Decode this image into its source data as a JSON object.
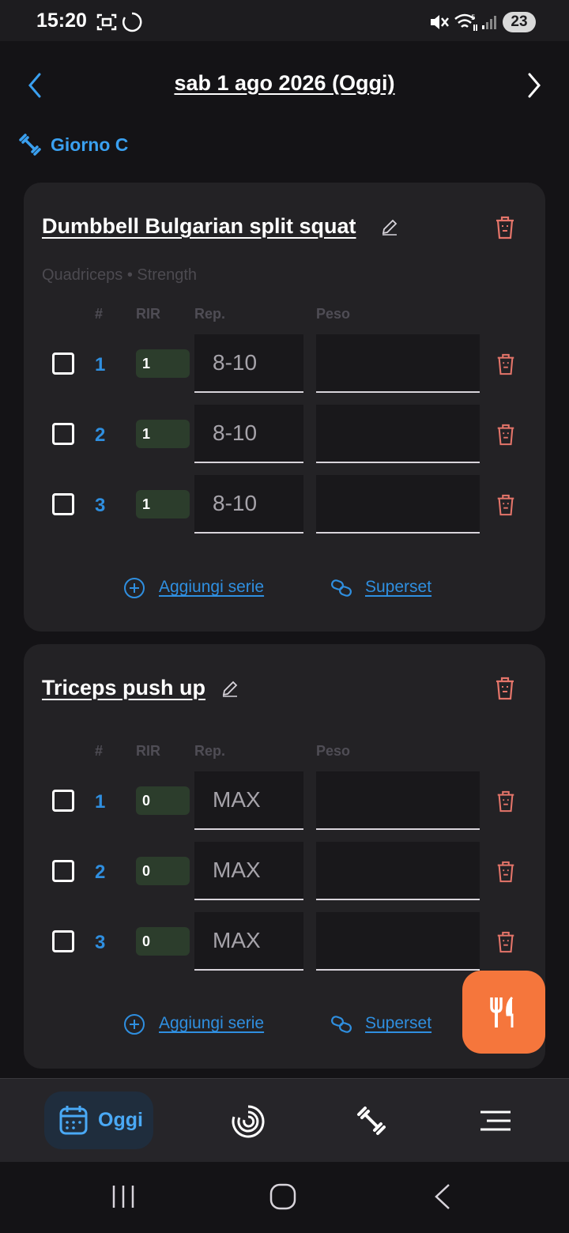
{
  "status_bar": {
    "time": "15:20",
    "battery": "23",
    "icons": [
      "screenshot-icon",
      "loading-circle-icon",
      "mute-icon",
      "wifi-icon",
      "signal-icon"
    ]
  },
  "header": {
    "date_title": "sab 1 ago 2026 (Oggi)",
    "prev_icon": "chevron-left-icon",
    "next_icon": "chevron-right-icon"
  },
  "workout_day": {
    "icon": "dumbbell-icon",
    "label": "Giorno C"
  },
  "columns": {
    "num": "#",
    "rir": "RIR",
    "rep": "Rep.",
    "peso": "Peso"
  },
  "exercises": [
    {
      "name": "Dumbbell Bulgarian split squat",
      "subtitle": "Quadriceps • Strength",
      "sets": [
        {
          "num": "1",
          "rir": "1",
          "rep": "8-10",
          "peso": ""
        },
        {
          "num": "2",
          "rir": "1",
          "rep": "8-10",
          "peso": ""
        },
        {
          "num": "3",
          "rir": "1",
          "rep": "8-10",
          "peso": ""
        }
      ],
      "add_set_label": "Aggiungi serie",
      "superset_label": "Superset"
    },
    {
      "name": "Triceps push up",
      "subtitle": "",
      "sets": [
        {
          "num": "1",
          "rir": "0",
          "rep": "MAX",
          "peso": ""
        },
        {
          "num": "2",
          "rir": "0",
          "rep": "MAX",
          "peso": ""
        },
        {
          "num": "3",
          "rir": "0",
          "rep": "MAX",
          "peso": ""
        }
      ],
      "add_set_label": "Aggiungi serie",
      "superset_label": "Superset"
    }
  ],
  "fab": {
    "icon": "fork-knife-icon"
  },
  "bottom_nav": {
    "items": [
      {
        "label": "Oggi",
        "icon": "calendar-icon",
        "active": true
      },
      {
        "label": "",
        "icon": "progress-ring-icon",
        "active": false
      },
      {
        "label": "",
        "icon": "dumbbell-icon",
        "active": false
      },
      {
        "label": "",
        "icon": "menu-icon",
        "active": false
      }
    ]
  },
  "colors": {
    "accent": "#2f8fe0",
    "danger": "#e5756a",
    "fab": "#f5763c",
    "card": "#232225",
    "background": "#141316"
  }
}
